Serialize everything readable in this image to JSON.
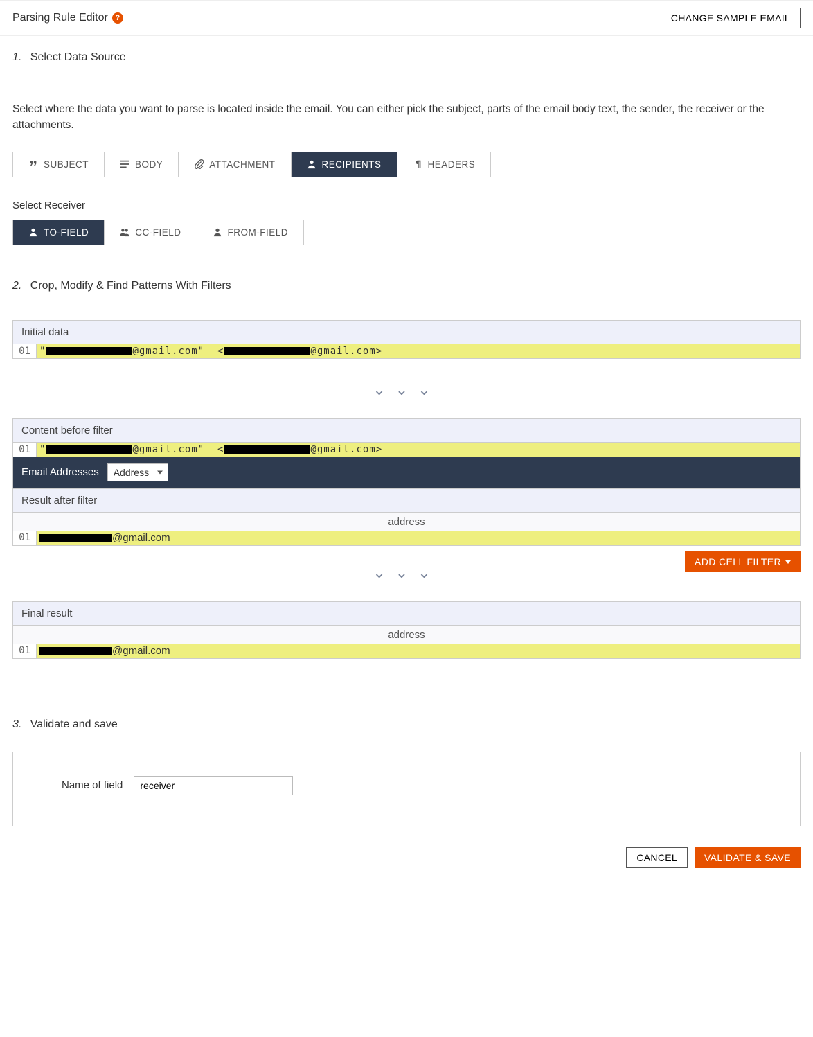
{
  "header": {
    "title": "Parsing Rule Editor",
    "change_sample_btn": "CHANGE SAMPLE EMAIL"
  },
  "step1": {
    "num": "1.",
    "title": "Select Data Source",
    "desc": "Select where the data you want to parse is located inside the email. You can either pick the subject, parts of the email body text, the sender, the receiver or the attachments.",
    "tabs": {
      "subject": "SUBJECT",
      "body": "BODY",
      "attachment": "ATTACHMENT",
      "recipients": "RECIPIENTS",
      "headers": "HEADERS"
    },
    "receiver_label": "Select Receiver",
    "receiver_tabs": {
      "to": "TO-FIELD",
      "cc": "CC-FIELD",
      "from": "FROM-FIELD"
    }
  },
  "step2": {
    "num": "2.",
    "title": "Crop, Modify & Find Patterns With Filters",
    "initial_data_label": "Initial data",
    "line_no": "01",
    "email_domain_a": "@gmail.com\"  <",
    "email_domain_b": "@gmail.com>",
    "content_before_label": "Content before filter",
    "filter_name": "Email Addresses",
    "filter_select_value": "Address",
    "result_after_label": "Result after filter",
    "col_header": "address",
    "result_domain": "@gmail.com",
    "add_cell_filter_btn": "ADD CELL FILTER",
    "final_result_label": "Final result"
  },
  "step3": {
    "num": "3.",
    "title": "Validate and save",
    "field_label": "Name of field",
    "field_value": "receiver"
  },
  "footer": {
    "cancel": "CANCEL",
    "validate": "VALIDATE & SAVE"
  }
}
